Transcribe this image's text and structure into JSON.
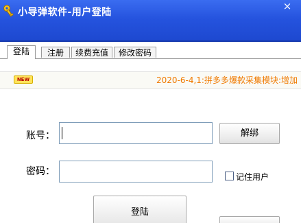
{
  "window": {
    "title": "小导弹软件-用户登陆",
    "close_label": "×"
  },
  "tabs": [
    {
      "label": "登陆",
      "active": true
    },
    {
      "label": "注册",
      "active": false
    },
    {
      "label": "续费充值",
      "active": false
    },
    {
      "label": "修改密码",
      "active": false
    }
  ],
  "notice": {
    "badge": "NEW",
    "text": "2020-6-4,1:拼多多爆款采集模块:增加"
  },
  "form": {
    "account_label": "账号：",
    "account_value": "",
    "password_label": "密码：",
    "password_value": "",
    "unbind_label": "解绑",
    "remember_label": "记住用户",
    "remember_checked": false,
    "login_label": "登陆"
  },
  "colors": {
    "titlebar": "#2553de",
    "notice_text": "#f07a00",
    "badge": "#ffe35a"
  }
}
